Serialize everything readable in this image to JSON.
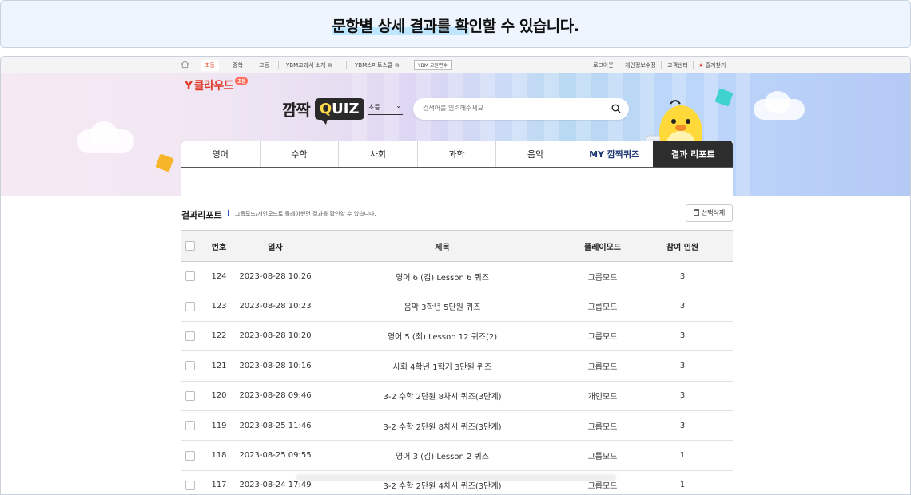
{
  "banner": {
    "text_highlight": "문항별 상세 결과를 확",
    "text_rest": "인할 수 있습니다."
  },
  "topbar": {
    "school_tabs": [
      "초등",
      "중학",
      "고등"
    ],
    "links": [
      {
        "label": "YBM교과서 소개"
      },
      {
        "label": "YBM스마트스쿨"
      }
    ],
    "ybm_box": "YBM 교원연수",
    "right_links": [
      "로그아웃",
      "개인정보수정",
      "고객센터",
      "즐겨찾기"
    ]
  },
  "logo": {
    "text": "클라우드",
    "badge": "초등"
  },
  "brand": {
    "korean": "깜짝",
    "quiz_q": "Q",
    "quiz_rest": "UIZ"
  },
  "level_select": {
    "value": "초등"
  },
  "search": {
    "placeholder": "검색어를 입력해주세요"
  },
  "tabs": [
    {
      "label": "영어"
    },
    {
      "label": "수학"
    },
    {
      "label": "사회"
    },
    {
      "label": "과학"
    },
    {
      "label": "음악"
    },
    {
      "label": "MY 깜짝퀴즈"
    },
    {
      "label": "결과 리포트"
    }
  ],
  "section": {
    "title": "결과리포트",
    "description": "그룹모드/개인모드로 플레이했던 결과를 확인할 수 있습니다.",
    "delete_label": "선택삭제"
  },
  "table": {
    "headers": {
      "num": "번호",
      "date": "일자",
      "title": "제목",
      "mode": "플레이모드",
      "count": "참여 인원"
    },
    "rows": [
      {
        "num": "124",
        "date": "2023-08-28 10:26",
        "title": "영어 6 (김) Lesson 6 퀴즈",
        "mode": "그룹모드",
        "count": "3"
      },
      {
        "num": "123",
        "date": "2023-08-28 10:23",
        "title": "음악 3학년 5단원 퀴즈",
        "mode": "그룹모드",
        "count": "3"
      },
      {
        "num": "122",
        "date": "2023-08-28 10:20",
        "title": "영어 5 (최) Lesson 12 퀴즈(2)",
        "mode": "그룹모드",
        "count": "3"
      },
      {
        "num": "121",
        "date": "2023-08-28 10:16",
        "title": "사회 4학년 1학기 3단원 퀴즈",
        "mode": "그룹모드",
        "count": "3"
      },
      {
        "num": "120",
        "date": "2023-08-28 09:46",
        "title": "3-2 수학 2단원 8차시 퀴즈(3단계)",
        "mode": "개인모드",
        "count": "3"
      },
      {
        "num": "119",
        "date": "2023-08-25 11:46",
        "title": "3-2 수학 2단원 8차시 퀴즈(3단계)",
        "mode": "그룹모드",
        "count": "3"
      },
      {
        "num": "118",
        "date": "2023-08-25 09:55",
        "title": "영어 3 (김) Lesson 2 퀴즈",
        "mode": "그룹모드",
        "count": "1"
      },
      {
        "num": "117",
        "date": "2023-08-24 17:49",
        "title": "3-2 수학 2단원 4차시 퀴즈(3단계)",
        "mode": "그룹모드",
        "count": "1"
      }
    ]
  },
  "colors": {
    "accent_red": "#e03a2a",
    "tab_active_bg": "#2d2d2d",
    "banner_bg": "#eef5ff"
  }
}
